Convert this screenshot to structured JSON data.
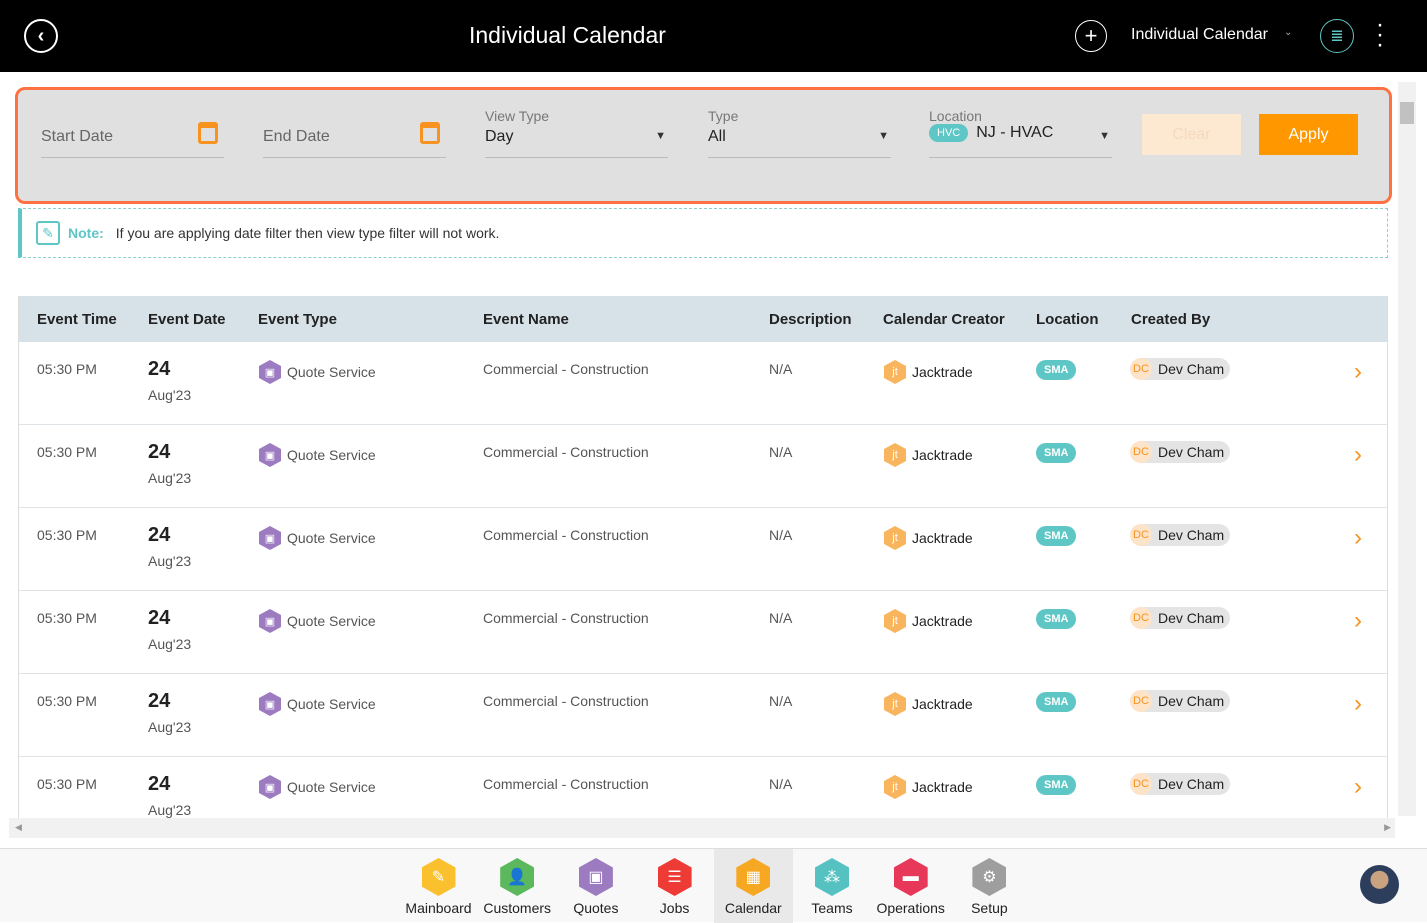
{
  "header": {
    "title": "Individual Calendar",
    "calendar_selector": "Individual Calendar",
    "icons": [
      "back-icon",
      "plus-icon",
      "list-icon",
      "more-vertical-icon"
    ]
  },
  "filters": {
    "start_date_placeholder": "Start Date",
    "end_date_placeholder": "End Date",
    "view_type": {
      "label": "View Type",
      "value": "Day"
    },
    "type": {
      "label": "Type",
      "value": "All"
    },
    "location": {
      "label": "Location",
      "badge": "HVC",
      "value": "NJ - HVAC"
    },
    "clear_label": "Clear",
    "apply_label": "Apply"
  },
  "note": {
    "label": "Note:",
    "text": "If you are applying date filter then view type filter will not work."
  },
  "table": {
    "columns": [
      "Event Time",
      "Event Date",
      "Event Type",
      "Event Name",
      "Description",
      "Calendar Creator",
      "Location",
      "Created By"
    ],
    "rows": [
      {
        "time": "05:30 PM",
        "day": "24",
        "month": "Aug'23",
        "type": "Quote Service",
        "name": "Commercial - Construction",
        "description": "N/A",
        "creator": "Jacktrade",
        "location": "SMA",
        "created_by_initials": "DC",
        "created_by": "Dev Cham"
      },
      {
        "time": "05:30 PM",
        "day": "24",
        "month": "Aug'23",
        "type": "Quote Service",
        "name": "Commercial - Construction",
        "description": "N/A",
        "creator": "Jacktrade",
        "location": "SMA",
        "created_by_initials": "DC",
        "created_by": "Dev Cham"
      },
      {
        "time": "05:30 PM",
        "day": "24",
        "month": "Aug'23",
        "type": "Quote Service",
        "name": "Commercial - Construction",
        "description": "N/A",
        "creator": "Jacktrade",
        "location": "SMA",
        "created_by_initials": "DC",
        "created_by": "Dev Cham"
      },
      {
        "time": "05:30 PM",
        "day": "24",
        "month": "Aug'23",
        "type": "Quote Service",
        "name": "Commercial - Construction",
        "description": "N/A",
        "creator": "Jacktrade",
        "location": "SMA",
        "created_by_initials": "DC",
        "created_by": "Dev Cham"
      },
      {
        "time": "05:30 PM",
        "day": "24",
        "month": "Aug'23",
        "type": "Quote Service",
        "name": "Commercial - Construction",
        "description": "N/A",
        "creator": "Jacktrade",
        "location": "SMA",
        "created_by_initials": "DC",
        "created_by": "Dev Cham"
      },
      {
        "time": "05:30 PM",
        "day": "24",
        "month": "Aug'23",
        "type": "Quote Service",
        "name": "Commercial - Construction",
        "description": "N/A",
        "creator": "Jacktrade",
        "location": "SMA",
        "created_by_initials": "DC",
        "created_by": "Dev Cham"
      }
    ]
  },
  "bottom_nav": [
    {
      "label": "Mainboard",
      "color": "#fbc02d",
      "icon": "mainboard-icon",
      "glyph": "✎"
    },
    {
      "label": "Customers",
      "color": "#5cb85c",
      "icon": "customer-icon",
      "glyph": "👤"
    },
    {
      "label": "Quotes",
      "color": "#9c7bc0",
      "icon": "quotes-icon",
      "glyph": "▣"
    },
    {
      "label": "Jobs",
      "color": "#ef3b36",
      "icon": "jobs-icon",
      "glyph": "☰"
    },
    {
      "label": "Calendar",
      "color": "#f7a823",
      "icon": "calendar-icon",
      "glyph": "▦",
      "active": true
    },
    {
      "label": "Teams",
      "color": "#55c1c1",
      "icon": "teams-icon",
      "glyph": "⁂"
    },
    {
      "label": "Operations",
      "color": "#e8385a",
      "icon": "operations-icon",
      "glyph": "▬"
    },
    {
      "label": "Setup",
      "color": "#9e9e9e",
      "icon": "gear-icon",
      "glyph": "⚙"
    }
  ],
  "colors": {
    "accent": "#f7931e",
    "teal": "#5ec6c4",
    "highlight_border": "#ff7043"
  }
}
